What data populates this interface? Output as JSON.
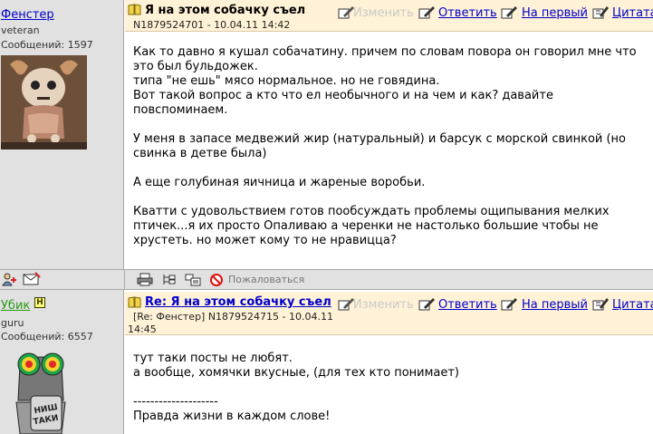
{
  "post1": {
    "author": "Фенстер",
    "role": "veteran",
    "count": "Сообщений: 1597",
    "title": "Я на этом собачку съел",
    "meta": "N1879524701 - 10.04.11 14:42",
    "actions": {
      "edit": "Изменить",
      "reply": "Ответить",
      "first": "На первый",
      "quote": "Цитата"
    },
    "lines": [
      "Как то давно я кушал собачатину. причем по словам повора он говорил мне что",
      "это был бульдожек.",
      "типа \"не ешь\" мясо нормальное. но не говядина.",
      "Вот такой вопрос а кто что ел необычного и на чем и как? давайте",
      "повспоминаем.",
      "У меня в запасе медвежий жир (натуральный) и барсук с морской свинкой (но",
      "свинка в детве была)",
      "А еще голубиная яичница и жареные воробьи.",
      "Кватти с удовольствием готов пообсуждать проблемы ощипывания мелких",
      "птичек...я их просто Опаливаю а черенки не настолько большие чтобы не",
      "хрустеть. но может кому то не нравицца?"
    ],
    "report": "Пожаловаться"
  },
  "post2": {
    "author": "Убик",
    "badge": "Н",
    "role": "guru",
    "count": "Сообщений: 6557",
    "title": "Re: Я на этом собачку съел",
    "meta1": "[Re: Фенстер]  N1879524715 - 10.04.11",
    "meta2": "14:45",
    "actions": {
      "edit": "Изменить",
      "reply": "Ответить",
      "first": "На первый",
      "quote": "Цитата"
    },
    "lines": [
      "тут таки посты не любят.",
      "а вообще, хомячки вкусные, (для тех кто понимает)",
      "--------------------",
      "Правда жизни в каждом слове!"
    ],
    "avatar_text": "НИШ ТАКИ"
  },
  "colors": {
    "link": "#0000cc",
    "header_bg": "#fff2d6",
    "side_bg": "#e1e1e1",
    "author2": "#2b9a17"
  }
}
